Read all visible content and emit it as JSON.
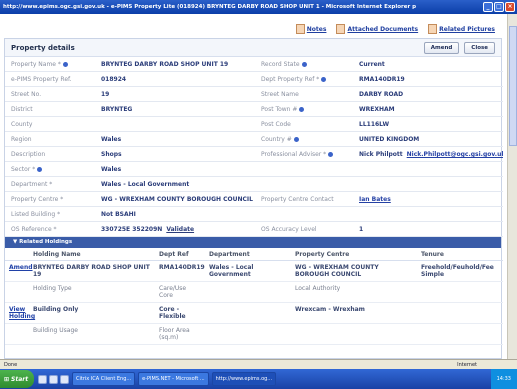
{
  "window": {
    "title": "http://www.epims.ogc.gsi.gov.uk - e-PIMS Property Lite (018924) BRYNTEG DARBY ROAD SHOP UNIT 1 - Microsoft Internet Explorer p"
  },
  "toplinks": {
    "notes": "Notes",
    "attached_documents": "Attached Documents",
    "related_pictures": "Related Pictures"
  },
  "header": {
    "title": "Property details",
    "amend": "Amend",
    "close": "Close"
  },
  "details": [
    {
      "l1": "Property Name *",
      "v1": "BRYNTEG DARBY ROAD SHOP UNIT 19",
      "l2": "Record State",
      "v2": "Current"
    },
    {
      "l1": "e-PIMS Property Ref.",
      "v1": "018924",
      "l2": "Dept Property Ref *",
      "v2": "RMA140DR19"
    },
    {
      "l1": "Street No.",
      "v1": "19",
      "l2": "Street Name",
      "v2": "DARBY ROAD"
    },
    {
      "l1": "District",
      "v1": "BRYNTEG",
      "l2": "Post Town #",
      "v2": "WREXHAM"
    },
    {
      "l1": "County",
      "v1": "",
      "l2": "Post Code",
      "v2": "LL116LW"
    },
    {
      "l1": "Region",
      "v1": "Wales",
      "l2": "Country #",
      "v2": "UNITED KINGDOM"
    },
    {
      "l1": "Description",
      "v1": "Shops",
      "l2": "Professional Adviser *",
      "v2": "Nick Philpott",
      "v2b": "Nick.Philpott@ogc.gsi.gov.uk"
    },
    {
      "l1": "Sector *",
      "v1": "Wales",
      "l2": "",
      "v2": ""
    },
    {
      "l1": "Department *",
      "v1": "Wales - Local Government",
      "l2": "",
      "v2": ""
    },
    {
      "l1": "Property Centre *",
      "v1": "WG - WREXHAM COUNTY BOROUGH COUNCIL",
      "l2": "Property Centre Contact",
      "v2": "Ian Bates"
    },
    {
      "l1": "Listed Building *",
      "v1": "Not BSAHI",
      "l2": "",
      "v2": ""
    },
    {
      "l1": "OS Reference *",
      "v1": "330725E 352209N",
      "v1b": "Validate",
      "l2": "OS Accuracy Level",
      "v2": "1"
    }
  ],
  "related": {
    "section_title": "Related Holdings",
    "headers": [
      "",
      "Holding Name",
      "Dept Ref",
      "Department",
      "Property Centre",
      "Tenure"
    ],
    "rows": [
      [
        "Amend",
        "BRYNTEG DARBY ROAD SHOP UNIT 19",
        "RMA140DR19",
        "Wales - Local Government",
        "WG - WREXHAM COUNTY BOROUGH COUNCIL",
        "Freehold/Feuhold/Fee Simple"
      ],
      [
        "",
        "Holding Type",
        "Care/Use Core",
        "",
        "Local Authority",
        ""
      ],
      [
        "View Holding",
        "Building Only",
        "Core - Flexible",
        "",
        "Wrexcam - Wrexham",
        ""
      ],
      [
        "",
        "Building Usage",
        "Floor Area (sq.m)",
        "",
        "",
        ""
      ]
    ]
  },
  "statusbar": {
    "left": "Done",
    "zone": "Internet"
  },
  "taskbar": {
    "start": "Start",
    "tasks": [
      "Citrix ICA Client Eng...",
      "e-PIMS.NET - Microsoft ...",
      "http://www.epims.og..."
    ],
    "clock": "14:33"
  }
}
